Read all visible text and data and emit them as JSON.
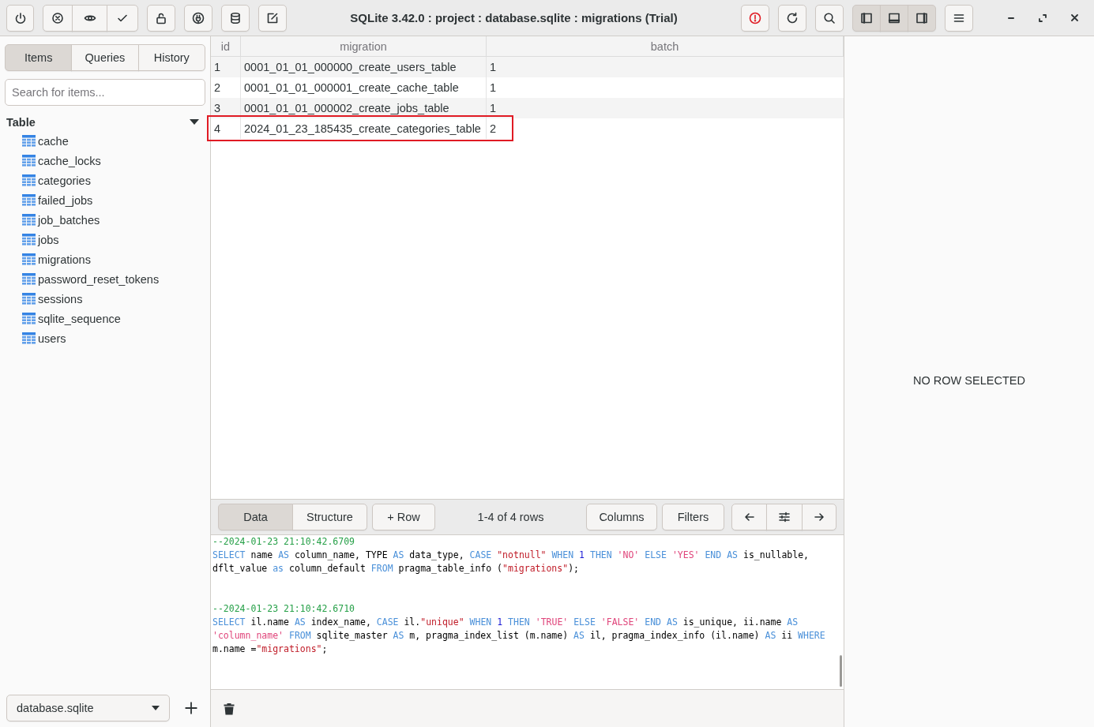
{
  "window": {
    "title": "SQLite 3.42.0 : project : database.sqlite : migrations (Trial)",
    "layout_toggles": [
      {
        "on": true
      },
      {
        "on": true
      },
      {
        "on": true
      }
    ]
  },
  "sidebar": {
    "tabs": [
      {
        "label": "Items",
        "selected": true
      },
      {
        "label": "Queries",
        "selected": false
      },
      {
        "label": "History",
        "selected": false
      }
    ],
    "search": {
      "placeholder": "Search for items..."
    },
    "tree": {
      "label": "Table",
      "expanded": true,
      "children": [
        {
          "label": "cache"
        },
        {
          "label": "cache_locks"
        },
        {
          "label": "categories"
        },
        {
          "label": "failed_jobs"
        },
        {
          "label": "job_batches"
        },
        {
          "label": "jobs"
        },
        {
          "label": "migrations"
        },
        {
          "label": "password_reset_tokens"
        },
        {
          "label": "sessions"
        },
        {
          "label": "sqlite_sequence"
        },
        {
          "label": "users"
        }
      ]
    },
    "database": "database.sqlite"
  },
  "table": {
    "columns": [
      "id",
      "migration",
      "batch"
    ],
    "rows": [
      {
        "cells": [
          "1",
          "0001_01_01_000000_create_users_table",
          "1"
        ],
        "highlighted": false
      },
      {
        "cells": [
          "2",
          "0001_01_01_000001_create_cache_table",
          "1"
        ],
        "highlighted": false
      },
      {
        "cells": [
          "3",
          "0001_01_01_000002_create_jobs_table",
          "1"
        ],
        "highlighted": false
      },
      {
        "cells": [
          "4",
          "2024_01_23_185435_create_categories_table",
          "2"
        ],
        "highlighted": true
      }
    ]
  },
  "table_toolbar": {
    "views": [
      {
        "label": "Data",
        "selected": true
      },
      {
        "label": "Structure",
        "selected": false
      }
    ],
    "add_row": "+ Row",
    "row_count": "1-4 of 4 rows",
    "columns": "Columns",
    "filters": "Filters"
  },
  "query_log": [
    {
      "lines": [
        [
          {
            "kind": "comment",
            "text": "--2024-01-23 21:10:42.6709"
          }
        ],
        [
          {
            "kind": "keyword",
            "text": "SELECT"
          },
          {
            "kind": "plain",
            "text": "name"
          },
          {
            "kind": "keyword",
            "text": "AS"
          },
          {
            "kind": "plain",
            "text": "column_name, TYPE"
          },
          {
            "kind": "keyword",
            "text": "AS"
          },
          {
            "kind": "plain",
            "text": "data_type,"
          },
          {
            "kind": "keyword",
            "text": "CASE"
          },
          {
            "kind": "dstring",
            "text": "\"notnull\""
          },
          {
            "kind": "keyword",
            "text": "WHEN"
          },
          {
            "kind": "number",
            "text": "1"
          },
          {
            "kind": "keyword",
            "text": "THEN"
          },
          {
            "kind": "sstring",
            "text": "'NO'"
          },
          {
            "kind": "keyword",
            "text": "ELSE"
          },
          {
            "kind": "sstring",
            "text": "'YES'"
          },
          {
            "kind": "keyword",
            "text": "END"
          },
          {
            "kind": "keyword",
            "text": "AS"
          },
          {
            "kind": "plain",
            "text": "is_nullable,"
          }
        ],
        [
          {
            "kind": "plain",
            "text": "dflt_value"
          },
          {
            "kind": "keyword",
            "text": "as"
          },
          {
            "kind": "plain",
            "text": "column_default"
          },
          {
            "kind": "keyword",
            "text": "FROM"
          },
          {
            "kind": "plain",
            "text": "pragma_table_info ("
          },
          {
            "kind": "dstring",
            "text": "\"migrations\"",
            "attached": true
          },
          {
            "kind": "plain",
            "text": ");",
            "attached": true
          }
        ]
      ]
    },
    {
      "lines": [
        [
          {
            "kind": "comment",
            "text": "--2024-01-23 21:10:42.6710"
          }
        ],
        [
          {
            "kind": "keyword",
            "text": "SELECT"
          },
          {
            "kind": "plain",
            "text": "il.name"
          },
          {
            "kind": "keyword",
            "text": "AS"
          },
          {
            "kind": "plain",
            "text": "index_name,"
          },
          {
            "kind": "keyword",
            "text": "CASE"
          },
          {
            "kind": "plain",
            "text": "il."
          },
          {
            "kind": "dstring",
            "text": "\"unique\"",
            "attached": true
          },
          {
            "kind": "keyword",
            "text": "WHEN"
          },
          {
            "kind": "number",
            "text": "1"
          },
          {
            "kind": "keyword",
            "text": "THEN"
          },
          {
            "kind": "sstring",
            "text": "'TRUE'"
          },
          {
            "kind": "keyword",
            "text": "ELSE"
          },
          {
            "kind": "sstring",
            "text": "'FALSE'"
          },
          {
            "kind": "keyword",
            "text": "END"
          },
          {
            "kind": "keyword",
            "text": "AS"
          },
          {
            "kind": "plain",
            "text": "is_unique, ii.name"
          },
          {
            "kind": "keyword",
            "text": "AS"
          }
        ],
        [
          {
            "kind": "sstring",
            "text": "'column_name'"
          },
          {
            "kind": "keyword",
            "text": "FROM"
          },
          {
            "kind": "plain",
            "text": "sqlite_master"
          },
          {
            "kind": "keyword",
            "text": "AS"
          },
          {
            "kind": "plain",
            "text": "m, pragma_index_list (m.name)"
          },
          {
            "kind": "keyword",
            "text": "AS"
          },
          {
            "kind": "plain",
            "text": "il, pragma_index_info (il.name)"
          },
          {
            "kind": "keyword",
            "text": "AS"
          },
          {
            "kind": "plain",
            "text": "ii"
          },
          {
            "kind": "keyword",
            "text": "WHERE"
          }
        ],
        [
          {
            "kind": "plain",
            "text": "m.name ="
          },
          {
            "kind": "dstring",
            "text": "\"migrations\"",
            "attached": true
          },
          {
            "kind": "plain",
            "text": ";",
            "attached": true
          }
        ]
      ]
    }
  ],
  "detail": {
    "empty_text": "NO ROW SELECTED"
  }
}
